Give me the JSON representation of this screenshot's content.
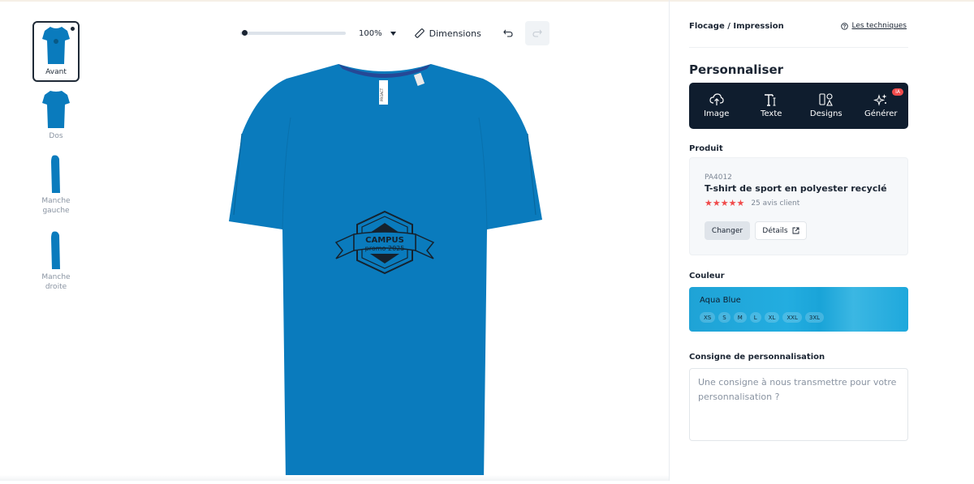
{
  "views": [
    {
      "label": "Avant",
      "active": true
    },
    {
      "label": "Dos",
      "active": false
    },
    {
      "label": "Manche\ngauche",
      "active": false
    },
    {
      "label": "Manche\ndroite",
      "active": false
    }
  ],
  "toolbar": {
    "zoom_level": "100%",
    "zoom_slider_value": 0.0,
    "dimensions_label": "Dimensions"
  },
  "design": {
    "badge_title": "CAMPUS",
    "badge_subtitle": "promo 2025",
    "shirt_color": "#0a7bbd",
    "neck_tag": "PROACT"
  },
  "panel": {
    "section_title": "Flocage / Impression",
    "techniques_link": "Les techniques",
    "personalize_heading": "Personnaliser",
    "tools": [
      {
        "label": "Image",
        "icon": "cloud-upload-icon"
      },
      {
        "label": "Texte",
        "icon": "text-icon"
      },
      {
        "label": "Designs",
        "icon": "shapes-icon"
      },
      {
        "label": "Générer",
        "icon": "sparkles-icon",
        "badge": "IA"
      }
    ],
    "product": {
      "section_label": "Produit",
      "ref": "PA4012",
      "name": "T-shirt de sport en polyester recyclé",
      "rating": 5,
      "reviews": "25 avis client",
      "change_label": "Changer",
      "details_label": "Détails"
    },
    "color": {
      "section_label": "Couleur",
      "name": "Aqua Blue",
      "hex": "#1fa3d6",
      "sizes": [
        "XS",
        "S",
        "M",
        "L",
        "XL",
        "XXL",
        "3XL"
      ]
    },
    "instructions": {
      "section_label": "Consigne de personnalisation",
      "placeholder": "Une consigne à nous transmettre pour votre personnalisation ?",
      "value": ""
    }
  }
}
